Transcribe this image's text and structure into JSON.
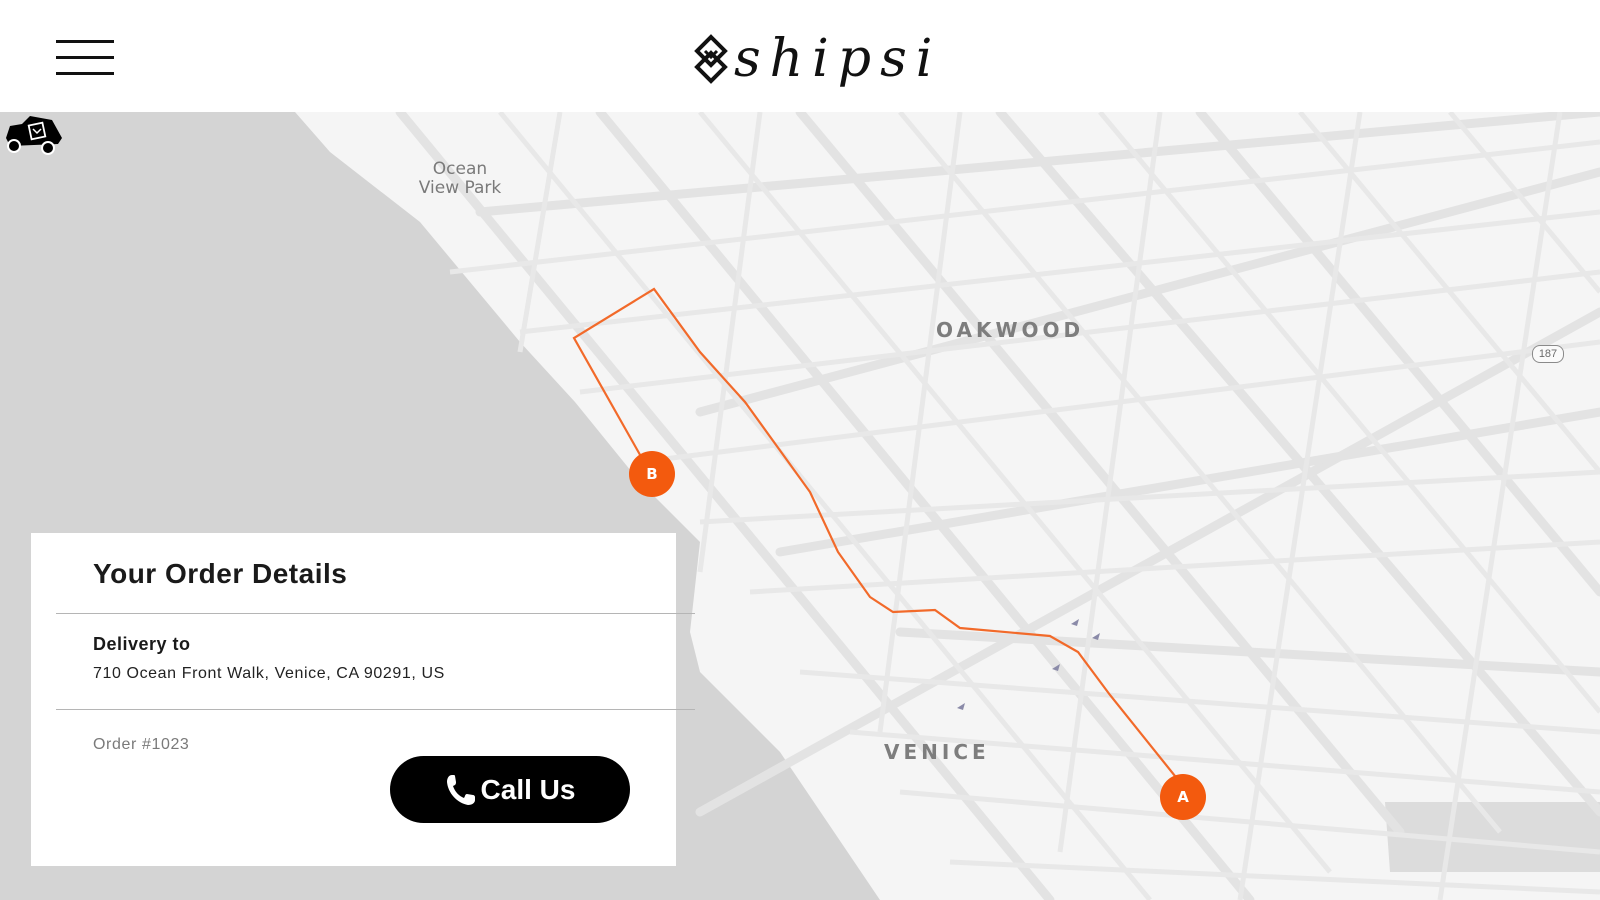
{
  "header": {
    "brand": "shipsi",
    "menu_icon": "hamburger-menu-icon",
    "logo_icon": "shipsi-logo-icon"
  },
  "map": {
    "labels": {
      "park": "Ocean\nView Park",
      "neighborhood_1": "OAKWOOD",
      "neighborhood_2": "VENICE",
      "route_shield": "187"
    },
    "markers": {
      "origin": "A",
      "destination": "B"
    },
    "courier_icon": "delivery-truck-icon",
    "colors": {
      "route": "#f26a2a",
      "marker": "#f35a0e",
      "water": "#d4d4d4",
      "land": "#f5f5f5",
      "streets": "#e2e2e2"
    }
  },
  "order_card": {
    "title": "Your Order Details",
    "delivery_label": "Delivery to",
    "delivery_address": "710 Ocean Front Walk, Venice, CA 90291, US",
    "order_number": "Order #1023",
    "call_button": {
      "label": "Call Us",
      "icon": "phone-icon"
    }
  }
}
